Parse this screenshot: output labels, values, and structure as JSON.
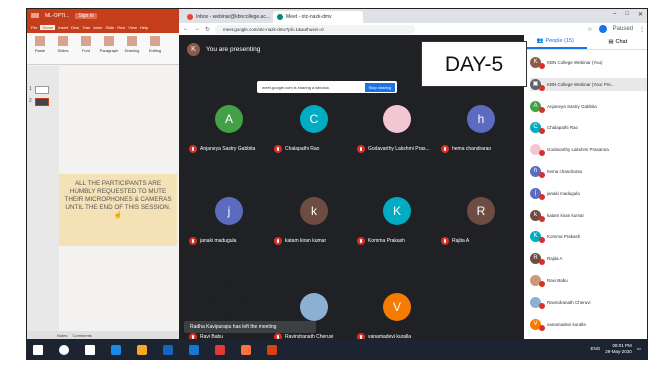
{
  "ppt": {
    "title": "ML-OPTI...",
    "signin": "Sign in",
    "tabs": [
      "File",
      "Home",
      "Insert",
      "Desi",
      "Tran",
      "Anim",
      "Slide",
      "Revi",
      "View",
      "Help"
    ],
    "ribbon": [
      "Paste",
      "Slides",
      "Font",
      "Paragraph",
      "Drawing",
      "Editing"
    ],
    "clipboard": "Clipboard",
    "slide_numbers": [
      "1",
      "2"
    ],
    "notice_lines": [
      "ALL THE PARTICIPANTS ARE",
      "HUMBLY REQUESTED TO MUTE",
      "THEIR MICROPHONES & CAMERAS",
      "UNTIL THE END OF THIS SESSION."
    ],
    "status": [
      "Notes",
      "Comments"
    ]
  },
  "chrome": {
    "tabs": [
      "Inbox - webinar@kbncollege.ac...",
      "Meet - otc-nazk-dmv"
    ],
    "url": "meet.google.com/otc-nazk-dmv?pli=1&authuser=0",
    "profile": "Paused",
    "winbtns": [
      "–",
      "□",
      "✕"
    ]
  },
  "meet": {
    "presenting": "You are presenting",
    "presenter_initial": "K",
    "share_msg": "meet.google.com is sharing a window.",
    "stop_label": "Stop sharing",
    "tiles": [
      {
        "initial": "A",
        "name": "Anjaneya Sastry Gabbita",
        "color": "#43a047"
      },
      {
        "initial": "C",
        "name": "Chalapathi Rao",
        "color": "#00acc1"
      },
      {
        "initial": "",
        "name": "Godavarthy Lakshmi Pras...",
        "color": "#f3c6d3"
      },
      {
        "initial": "h",
        "name": "hema chandrarao",
        "color": "#5c6bc0"
      },
      {
        "initial": "j",
        "name": "janaki madugula",
        "color": "#5c6bc0"
      },
      {
        "initial": "k",
        "name": "katam kiran kumar",
        "color": "#6d4c41"
      },
      {
        "initial": "K",
        "name": "Komma Prakash",
        "color": "#00acc1"
      },
      {
        "initial": "R",
        "name": "Rajita A",
        "color": "#6d4c41"
      },
      {
        "initial": "",
        "name": "Ravi Babu",
        "color": "#202124"
      },
      {
        "initial": "",
        "name": "Ravindranath Cheruvi",
        "color": "#8bb0d4"
      },
      {
        "initial": "V",
        "name": "vanamadevi kuralla",
        "color": "#f57c00"
      }
    ],
    "toast": "Radha Kavipurapu has left the meeting"
  },
  "day_label": "DAY-5",
  "people": {
    "tab_people": "People (15)",
    "tab_chat": "Chat",
    "list": [
      {
        "initial": "K",
        "name": "KBN College Webinar (You)",
        "color": "#8d5a4a"
      },
      {
        "initial": "▣",
        "name": "KBN College Webinar (Your Pre...",
        "color": "#5f6368"
      },
      {
        "initial": "A",
        "name": "Anjaneya Sastry Gabbita",
        "color": "#43a047"
      },
      {
        "initial": "C",
        "name": "Chalapathi Rao",
        "color": "#00acc1"
      },
      {
        "initial": "",
        "name": "Godavarthy Lakshmi Prasanna",
        "color": "#f3c6d3"
      },
      {
        "initial": "h",
        "name": "hema chandrarao",
        "color": "#5c6bc0"
      },
      {
        "initial": "j",
        "name": "janaki madugula",
        "color": "#5c6bc0"
      },
      {
        "initial": "k",
        "name": "katam kiran kumar",
        "color": "#6d4c41"
      },
      {
        "initial": "K",
        "name": "Komma Prakash",
        "color": "#00acc1"
      },
      {
        "initial": "R",
        "name": "Rajita A",
        "color": "#6d4c41"
      },
      {
        "initial": "",
        "name": "Ravi Babu",
        "color": "#c99a7a"
      },
      {
        "initial": "",
        "name": "Ravindranath Cheruvi",
        "color": "#8bb0d4"
      },
      {
        "initial": "V",
        "name": "vanamadevi kuralla",
        "color": "#f57c00"
      }
    ]
  },
  "taskbar": {
    "time": "08:01 PM",
    "date": "29-May-2020",
    "lang": "ENG",
    "icons": [
      "windows-icon",
      "search-icon",
      "task-view-icon",
      "edge-icon",
      "file-explorer-icon",
      "store-icon",
      "mail-icon",
      "chrome-icon",
      "firefox-icon",
      "powerpoint-icon"
    ],
    "icon_colors": [
      "#fff",
      "#fff",
      "#fff",
      "#1e88e5",
      "#f9a825",
      "#1565c0",
      "#1976d2",
      "#e53935",
      "#ff7043",
      "#d84315"
    ]
  }
}
